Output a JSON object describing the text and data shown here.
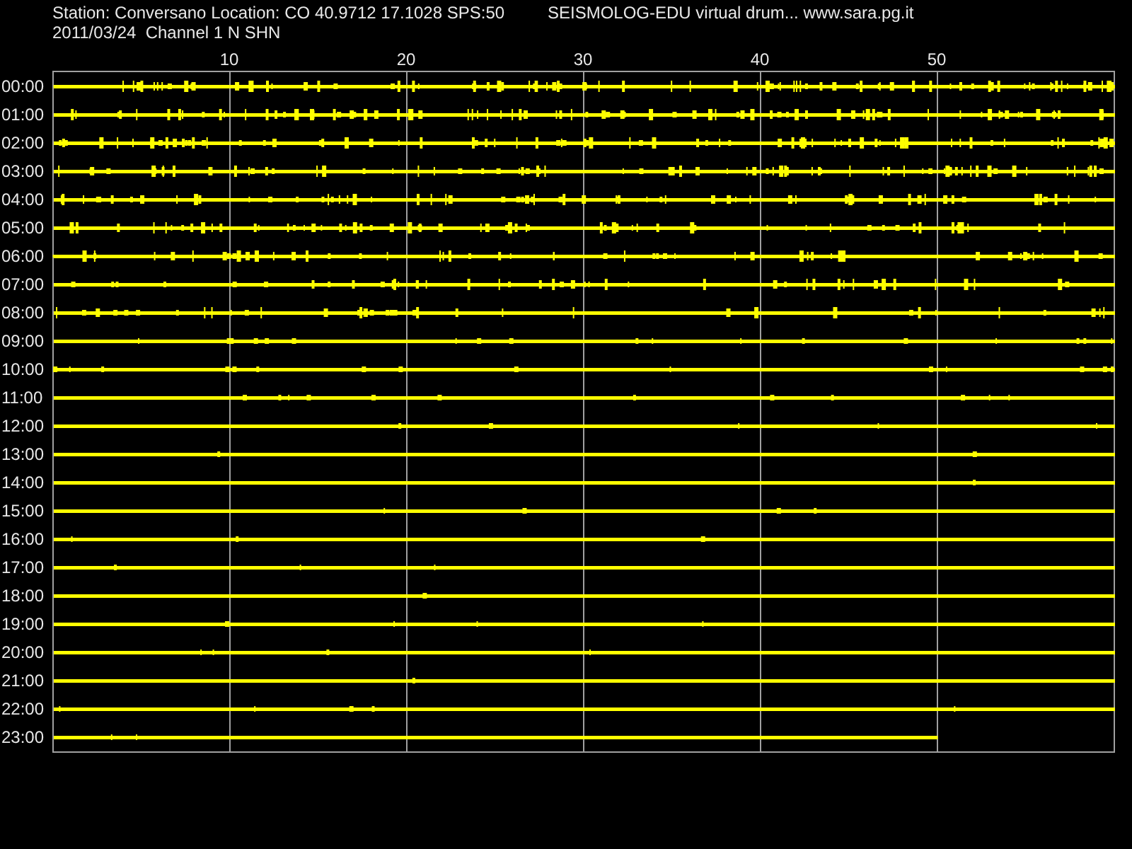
{
  "header": {
    "station": "Station: Conversano Location: CO 40.9712 17.1028 SPS:50",
    "title": "SEISMOLOG-EDU virtual drum... www.sara.pg.it",
    "date_channel": "2011/03/24  Channel 1 N SHN"
  },
  "minute_ticks": [
    "10",
    "20",
    "30",
    "40",
    "50"
  ],
  "hours": [
    {
      "label": "00:00",
      "level": 1
    },
    {
      "label": "01:00",
      "level": 1
    },
    {
      "label": "02:00",
      "level": 1
    },
    {
      "label": "03:00",
      "level": 1
    },
    {
      "label": "04:00",
      "level": 1
    },
    {
      "label": "05:00",
      "level": 1
    },
    {
      "label": "06:00",
      "level": 1
    },
    {
      "label": "07:00",
      "level": 1
    },
    {
      "label": "08:00",
      "level": 1
    },
    {
      "label": "09:00",
      "level": 1
    },
    {
      "label": "10:00",
      "level": 1
    },
    {
      "label": "11:00",
      "level": 1
    },
    {
      "label": "12:00",
      "level": 1
    },
    {
      "label": "13:00",
      "level": 1
    },
    {
      "label": "14:00",
      "level": 1
    },
    {
      "label": "15:00",
      "level": 1
    },
    {
      "label": "16:00",
      "level": 1
    },
    {
      "label": "17:00",
      "level": 1
    },
    {
      "label": "18:00",
      "level": 1
    },
    {
      "label": "19:00",
      "level": 1
    },
    {
      "label": "20:00",
      "level": 1
    },
    {
      "label": "21:00",
      "level": 1
    },
    {
      "label": "22:00",
      "level": 1
    },
    {
      "label": "23:00",
      "level": 0.833
    }
  ]
}
